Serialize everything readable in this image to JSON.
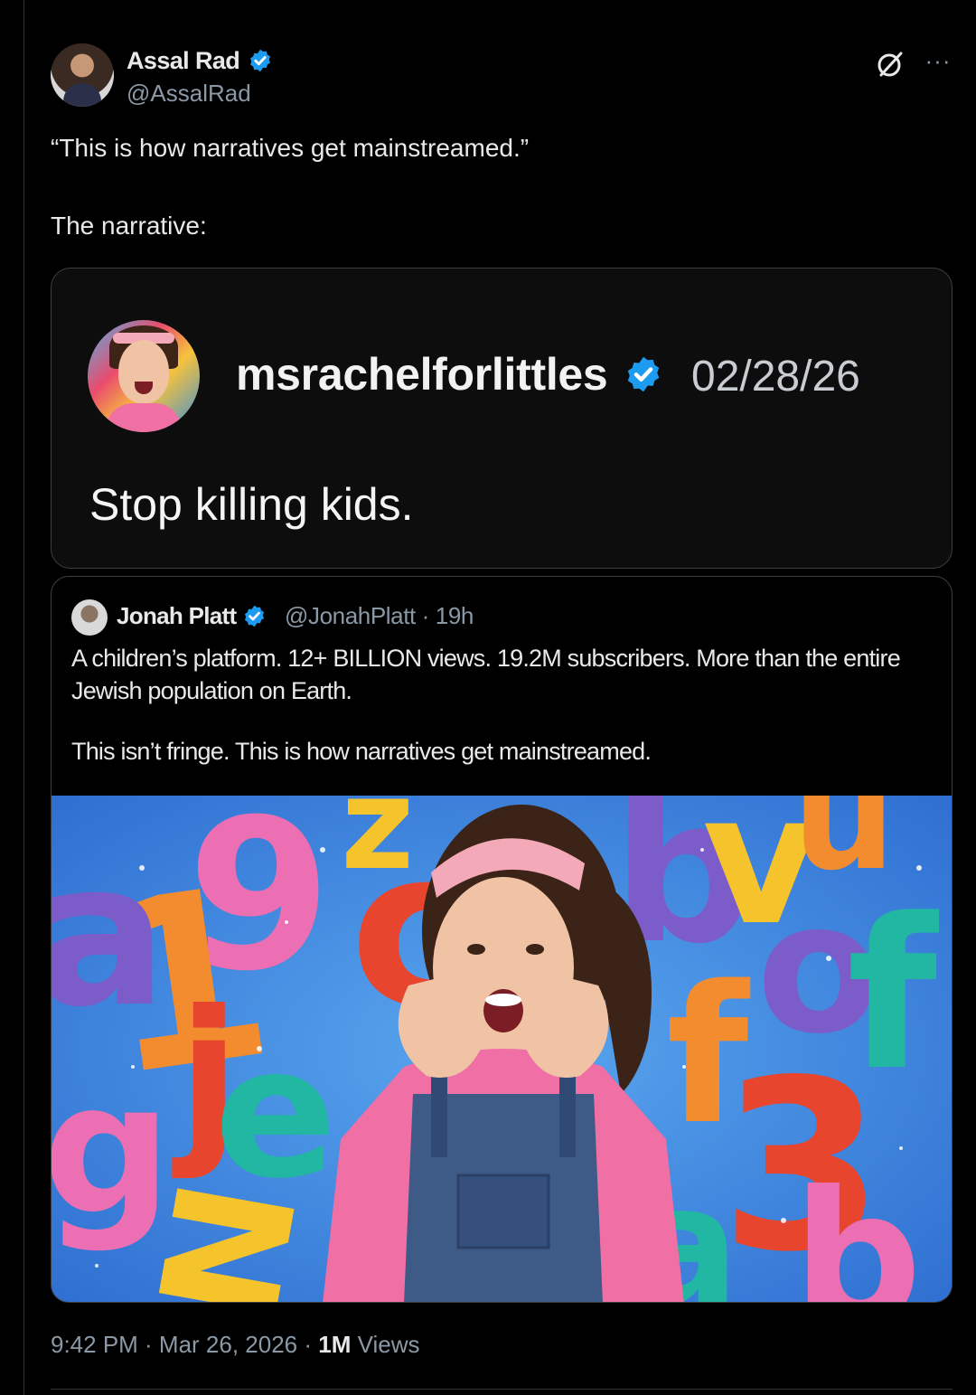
{
  "post": {
    "author_name": "Assal Rad",
    "author_handle": "@AssalRad",
    "text_line1": "“This is how narratives get mainstreamed.”",
    "text_line2": "The narrative:",
    "timestamp": "9:42 PM · Mar 26, 2026 · ",
    "views_count": "1M",
    "views_label": " Views",
    "icons": [
      "grok-icon",
      "more-icon",
      "verified-badge-icon"
    ]
  },
  "embedded_screenshot": {
    "account": "msrachelforlittles",
    "date": "02/28/26",
    "text": "Stop killing kids."
  },
  "quoted_post": {
    "author_name": "Jonah Platt",
    "author_handle": "@JonahPlatt · 19h",
    "text_line1": "A children’s platform. 12+ BILLION views. 19.2M subscribers. More than the entire Jewish population on Earth.",
    "text_line2": "This isn’t fringe. This is how narratives get mainstreamed."
  },
  "colors": {
    "background": "#000000",
    "text": "#e7e9ea",
    "secondary_text": "#8b98a5",
    "verified_blue": "#1d9bf0",
    "border": "#3b3f44"
  }
}
